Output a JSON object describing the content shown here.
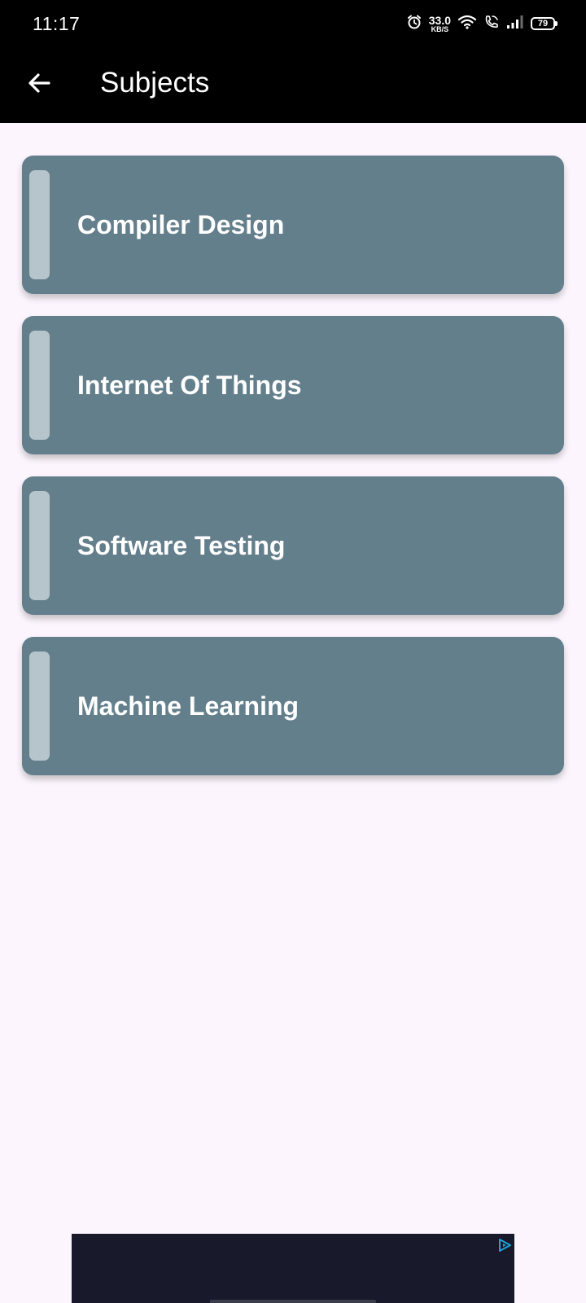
{
  "status_bar": {
    "time": "11:17",
    "net_speed_value": "33.0",
    "net_speed_unit": "KB/S",
    "battery_level": "79",
    "icons": [
      "alarm-icon",
      "wifi-icon",
      "wifi-call-icon",
      "signal-icon",
      "battery-icon"
    ]
  },
  "app_bar": {
    "back_icon": "arrow-left-icon",
    "title": "Subjects"
  },
  "subjects": [
    {
      "label": "Compiler Design"
    },
    {
      "label": "Internet Of Things"
    },
    {
      "label": "Software Testing"
    },
    {
      "label": "Machine Learning"
    }
  ],
  "colors": {
    "background": "#fcf5fd",
    "app_bar": "#000000",
    "card": "#637f8c",
    "card_accent": "#b6c4cb",
    "card_text": "#ffffff",
    "ad_background": "#181a2b",
    "ad_icon": "#1aa5d8"
  },
  "ad": {
    "icon": "ad-choices-icon"
  }
}
